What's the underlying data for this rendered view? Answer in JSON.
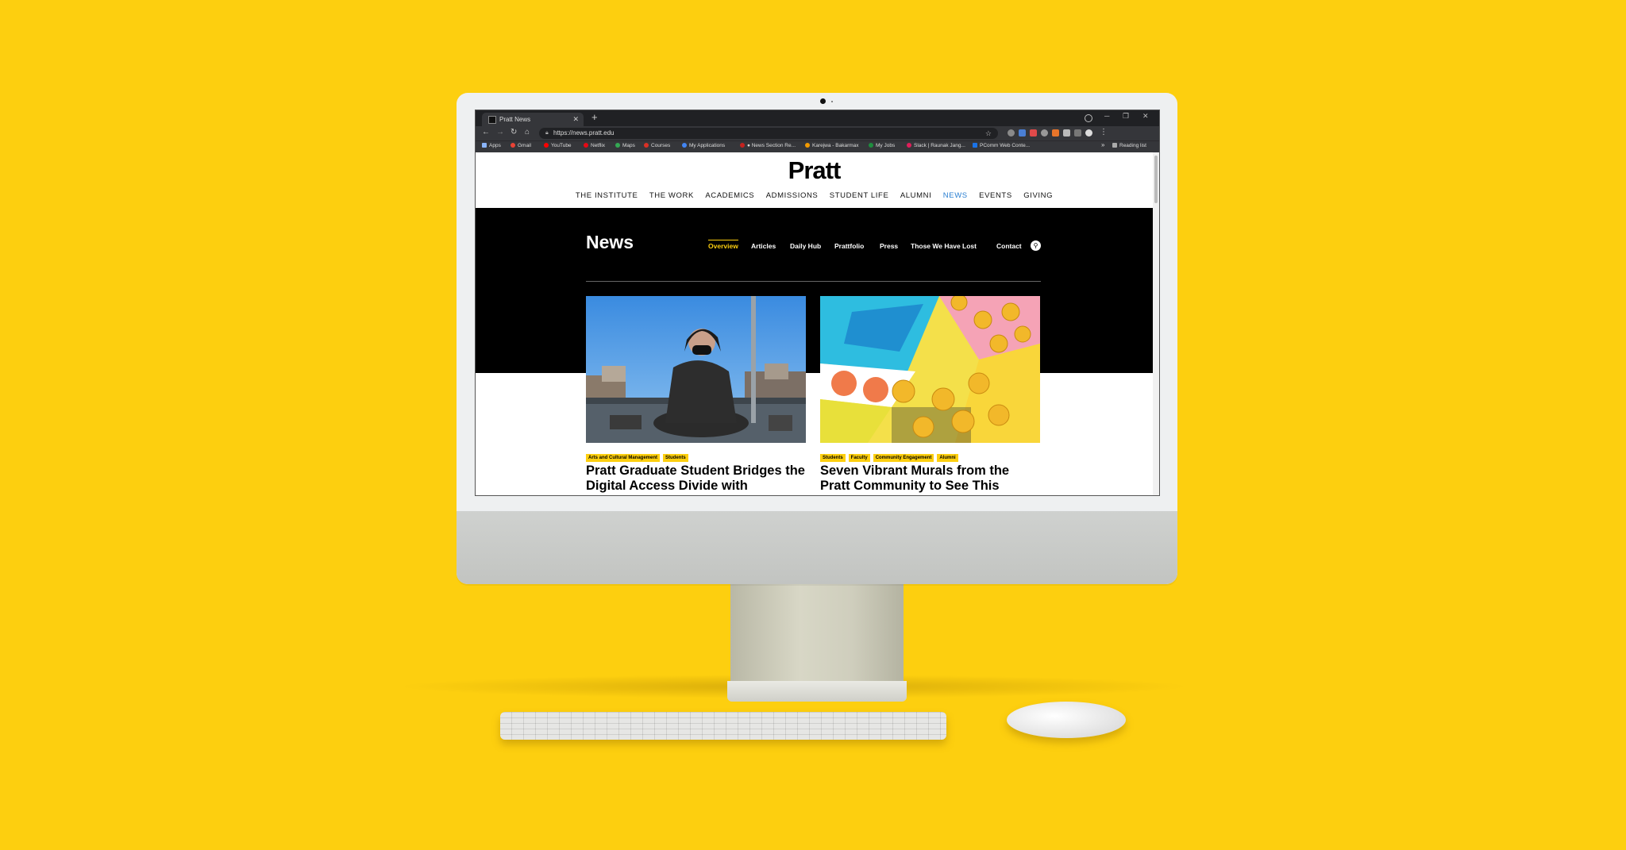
{
  "browser": {
    "tab_title": "Pratt News",
    "tab_close": "✕",
    "new_tab": "+",
    "url": "https://news.pratt.edu",
    "window_controls": [
      "─",
      "❐",
      "✕"
    ],
    "bookmarks": [
      {
        "label": "Apps",
        "color": "#8ab4f8"
      },
      {
        "label": "Gmail",
        "color": "#ea4335"
      },
      {
        "label": "YouTube",
        "color": "#ff0000"
      },
      {
        "label": "Netflix",
        "color": "#e50914"
      },
      {
        "label": "Maps",
        "color": "#34a853"
      },
      {
        "label": "Courses",
        "color": "#d93025"
      },
      {
        "label": "My Applications",
        "color": "#4285f4"
      },
      {
        "label": "● News Section Re...",
        "color": "#c5221f"
      },
      {
        "label": "Karejwa - Bakarmax",
        "color": "#f29900"
      },
      {
        "label": "My Jobs",
        "color": "#1e8e3e"
      },
      {
        "label": "Slack | Raunak Jang...",
        "color": "#e01e5a"
      },
      {
        "label": "PComm Web Conte...",
        "color": "#1a73e8"
      }
    ],
    "bookmarks_more": "»",
    "reading_list": "Reading list"
  },
  "site": {
    "logo": "Pratt",
    "nav": [
      "THE INSTITUTE",
      "THE WORK",
      "ACADEMICS",
      "ADMISSIONS",
      "STUDENT LIFE",
      "ALUMNI",
      "NEWS",
      "EVENTS",
      "GIVING"
    ],
    "nav_active": "NEWS",
    "section_title": "News",
    "subnav": [
      "Overview",
      "Articles",
      "Daily Hub",
      "Prattfolio",
      "Press",
      "Those We Have Lost",
      "Contact"
    ],
    "subnav_active": "Overview",
    "cards": [
      {
        "tags": [
          "Arts and Cultural Management",
          "Students"
        ],
        "title": "Pratt Graduate Student Bridges the Digital Access Divide with"
      },
      {
        "tags": [
          "Students",
          "Faculty",
          "Community Engagement",
          "Alumni"
        ],
        "title": "Seven Vibrant Murals from the Pratt Community to See This"
      }
    ]
  },
  "colors": {
    "background": "#FDCF0F",
    "accent": "#FDCF0F",
    "nav_active": "#2a7fd1",
    "band": "#000000"
  },
  "icons": {
    "search": "search-icon",
    "back": "arrow-left-icon",
    "forward": "arrow-right-icon",
    "reload": "reload-icon",
    "home": "home-icon",
    "lock": "lock-icon",
    "star": "star-icon"
  }
}
